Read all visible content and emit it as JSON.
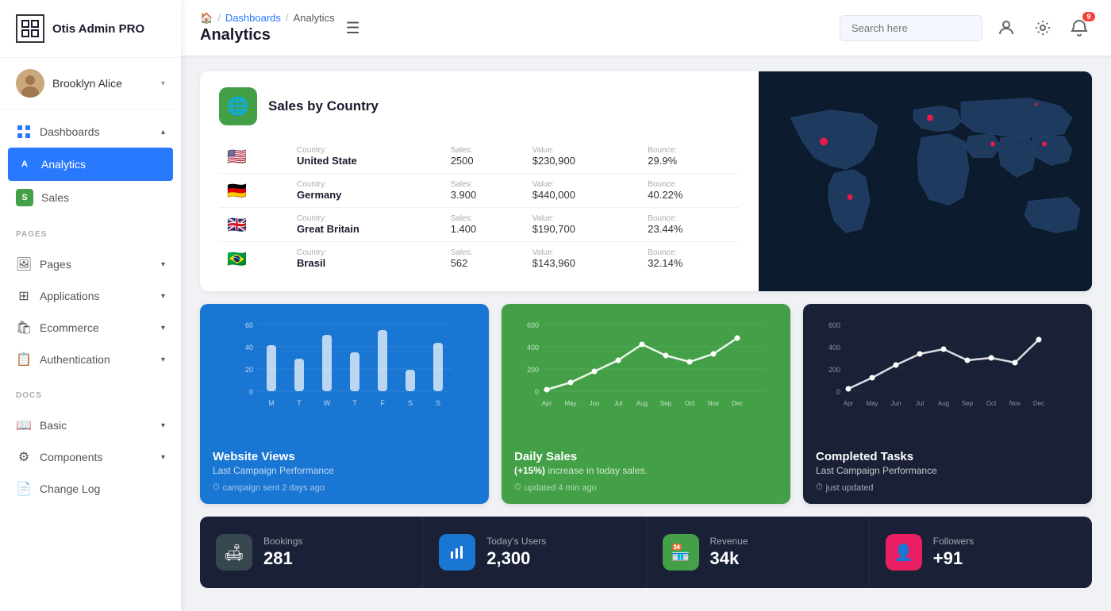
{
  "app": {
    "name": "Otis Admin PRO"
  },
  "user": {
    "name": "Brooklyn Alice",
    "avatar_emoji": "👩"
  },
  "sidebar": {
    "nav": [
      {
        "id": "dashboards",
        "label": "Dashboards",
        "icon": "⊞",
        "type": "parent",
        "expanded": true
      },
      {
        "id": "analytics",
        "label": "Analytics",
        "badge": "A",
        "badge_color": "blue",
        "active": true
      },
      {
        "id": "sales",
        "label": "Sales",
        "badge": "S",
        "badge_color": "green"
      }
    ],
    "pages_section": "PAGES",
    "pages": [
      {
        "id": "pages",
        "label": "Pages",
        "icon": "🖼"
      },
      {
        "id": "applications",
        "label": "Applications",
        "icon": "⊞"
      },
      {
        "id": "ecommerce",
        "label": "Ecommerce",
        "icon": "🛍"
      },
      {
        "id": "authentication",
        "label": "Authentication",
        "icon": "📋"
      }
    ],
    "docs_section": "DOCS",
    "docs": [
      {
        "id": "basic",
        "label": "Basic",
        "icon": "📖"
      },
      {
        "id": "components",
        "label": "Components",
        "icon": "⚙"
      },
      {
        "id": "changelog",
        "label": "Change Log",
        "icon": "📄"
      }
    ]
  },
  "header": {
    "breadcrumb": {
      "home": "🏠",
      "sep1": "/",
      "dashboards": "Dashboards",
      "sep2": "/",
      "current": "Analytics"
    },
    "title": "Analytics",
    "hamburger": "☰",
    "search_placeholder": "Search here",
    "notif_count": "9"
  },
  "sales_by_country": {
    "title": "Sales by Country",
    "icon": "🌐",
    "countries": [
      {
        "flag": "🇺🇸",
        "country_label": "Country:",
        "country_name": "United State",
        "sales_label": "Sales:",
        "sales_value": "2500",
        "value_label": "Value:",
        "value_amount": "$230,900",
        "bounce_label": "Bounce:",
        "bounce_pct": "29.9%"
      },
      {
        "flag": "🇩🇪",
        "country_label": "Country:",
        "country_name": "Germany",
        "sales_label": "Sales:",
        "sales_value": "3.900",
        "value_label": "Value:",
        "value_amount": "$440,000",
        "bounce_label": "Bounce:",
        "bounce_pct": "40.22%"
      },
      {
        "flag": "🇬🇧",
        "country_label": "Country:",
        "country_name": "Great Britain",
        "sales_label": "Sales:",
        "sales_value": "1.400",
        "value_label": "Value:",
        "value_amount": "$190,700",
        "bounce_label": "Bounce:",
        "bounce_pct": "23.44%"
      },
      {
        "flag": "🇧🇷",
        "country_label": "Country:",
        "country_name": "Brasil",
        "sales_label": "Sales:",
        "sales_value": "562",
        "value_label": "Value:",
        "value_amount": "$143,960",
        "bounce_label": "Bounce:",
        "bounce_pct": "32.14%"
      }
    ]
  },
  "charts": {
    "website_views": {
      "title": "Website Views",
      "subtitle": "Last Campaign Performance",
      "time": "campaign sent 2 days ago",
      "y_labels": [
        "0",
        "20",
        "40",
        "60"
      ],
      "x_labels": [
        "M",
        "T",
        "W",
        "T",
        "F",
        "S",
        "S"
      ],
      "bars": [
        45,
        30,
        55,
        38,
        60,
        22,
        48
      ]
    },
    "daily_sales": {
      "title": "Daily Sales",
      "highlight": "(+15%)",
      "subtitle": "increase in today sales.",
      "time": "updated 4 min ago",
      "y_labels": [
        "0",
        "200",
        "400",
        "600"
      ],
      "x_labels": [
        "Apr",
        "May",
        "Jun",
        "Jul",
        "Aug",
        "Sep",
        "Oct",
        "Nov",
        "Dec"
      ],
      "points": [
        10,
        80,
        180,
        280,
        420,
        320,
        260,
        340,
        480
      ]
    },
    "completed_tasks": {
      "title": "Completed Tasks",
      "subtitle": "Last Campaign Performance",
      "time": "just updated",
      "y_labels": [
        "0",
        "200",
        "400",
        "600"
      ],
      "x_labels": [
        "Apr",
        "May",
        "Jun",
        "Jul",
        "Aug",
        "Sep",
        "Oct",
        "Nov",
        "Dec"
      ],
      "points": [
        20,
        120,
        240,
        340,
        380,
        280,
        300,
        260,
        460
      ]
    }
  },
  "stats": [
    {
      "id": "bookings",
      "icon": "🛋",
      "icon_style": "gray",
      "label": "Bookings",
      "value": "281"
    },
    {
      "id": "today_users",
      "icon": "📊",
      "icon_style": "blue",
      "label": "Today's Users",
      "value": "2,300"
    },
    {
      "id": "revenue",
      "icon": "🏪",
      "icon_style": "green",
      "label": "Revenue",
      "value": "34k"
    },
    {
      "id": "followers",
      "icon": "👤",
      "icon_style": "pink",
      "label": "Followers",
      "value": "+91"
    }
  ]
}
